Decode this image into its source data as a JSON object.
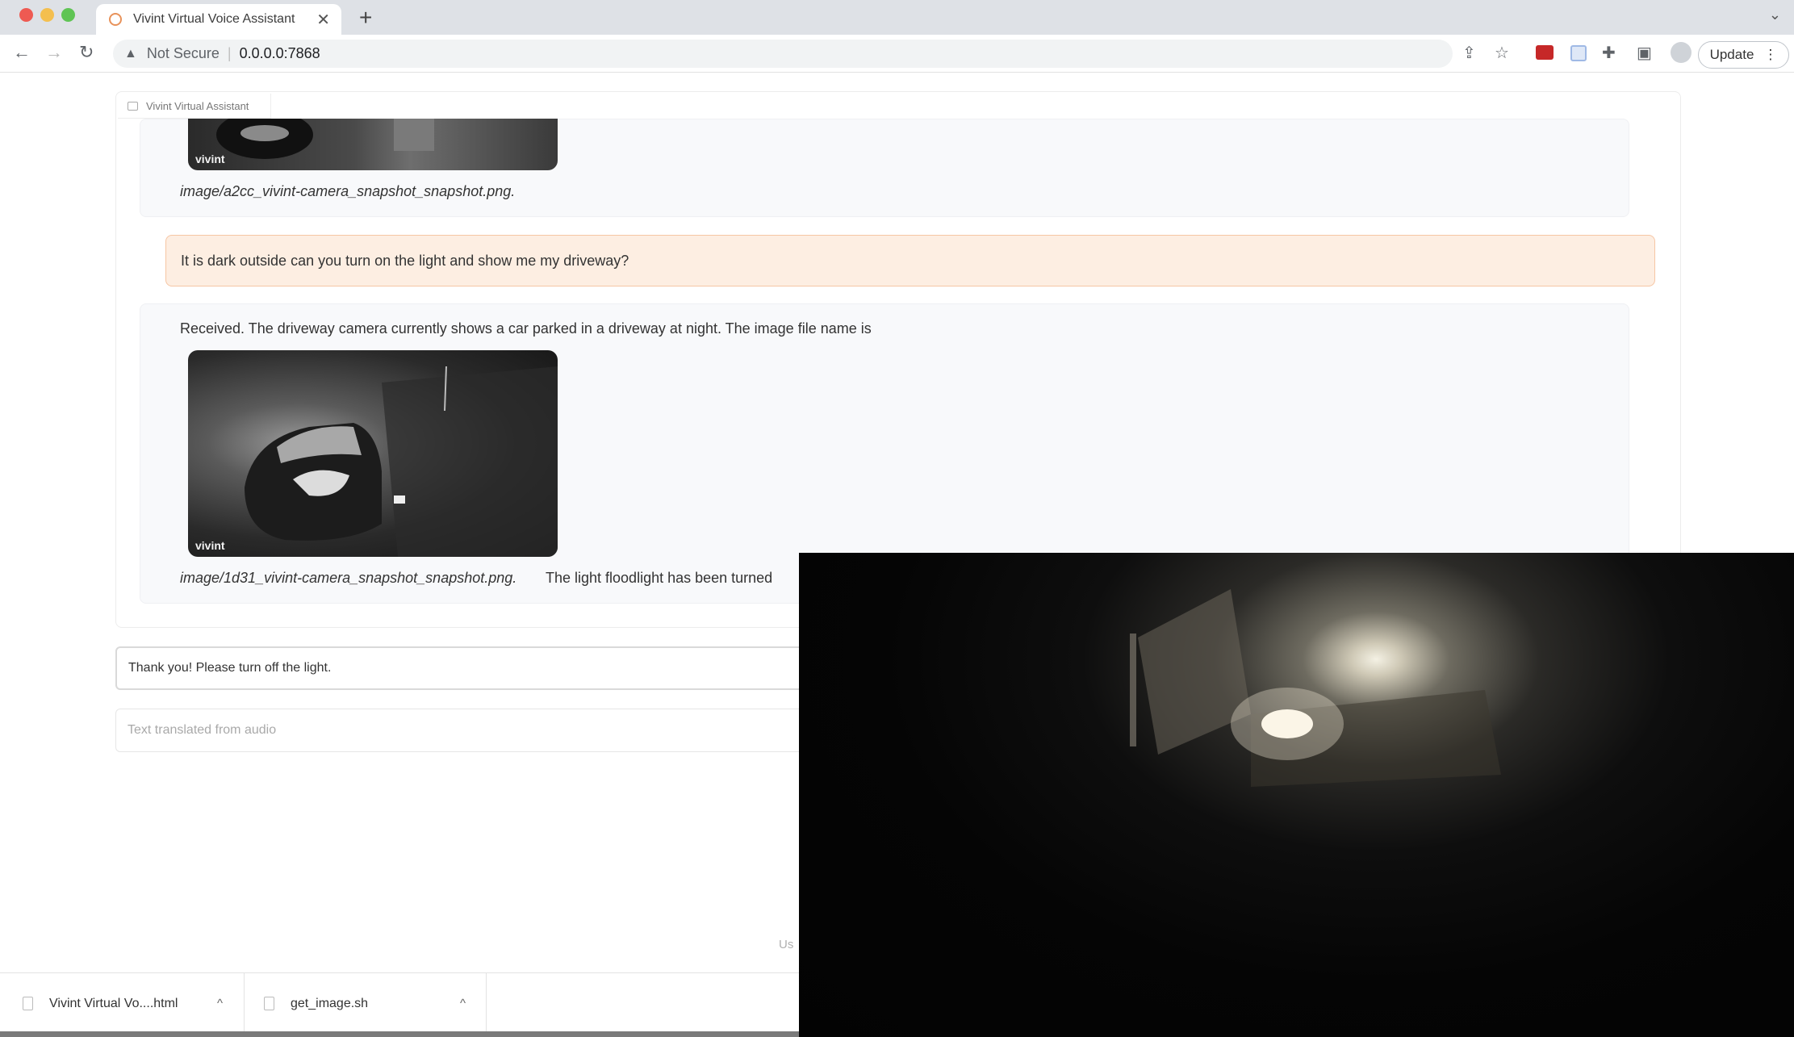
{
  "browser": {
    "tab_title": "Vivint Virtual Voice Assistant",
    "tab_close": "✕",
    "new_tab": "+",
    "tab_menu": "⌄",
    "nav": {
      "back": "←",
      "forward": "→",
      "reload": "↻"
    },
    "security_label": "Not Secure",
    "url": "0.0.0.0:7868",
    "update_label": "Update",
    "update_menu": "⋮"
  },
  "chat": {
    "label": "Vivint Virtual Assistant",
    "messages": [
      {
        "role": "assistant",
        "image_logo": "vivint",
        "filename": "image/a2cc_vivint-camera_snapshot_snapshot.png."
      },
      {
        "role": "user",
        "text": "It is dark outside can you turn on the light and show me my driveway?"
      },
      {
        "role": "assistant",
        "text": "Received. The driveway camera currently shows a car parked in a driveway at night. The image file name is",
        "image_logo": "vivint",
        "filename": "image/1d31_vivint-camera_snapshot_snapshot.png.",
        "text_after": " The light floodlight has been turned"
      }
    ]
  },
  "inputs": {
    "message_value": "Thank you! Please turn off the light.",
    "audio_placeholder": "Text translated from audio"
  },
  "footer_partial": "Us",
  "downloads": [
    {
      "name": "Vivint Virtual Vo....html",
      "chevron": "^"
    },
    {
      "name": "get_image.sh",
      "chevron": "^"
    }
  ],
  "icons": {
    "warning": "warning-triangle-icon",
    "share": "share-icon",
    "bookmark": "star-icon",
    "extensions": "puzzle-icon",
    "sidepanel": "side-panel-icon",
    "profile": "avatar-icon"
  }
}
